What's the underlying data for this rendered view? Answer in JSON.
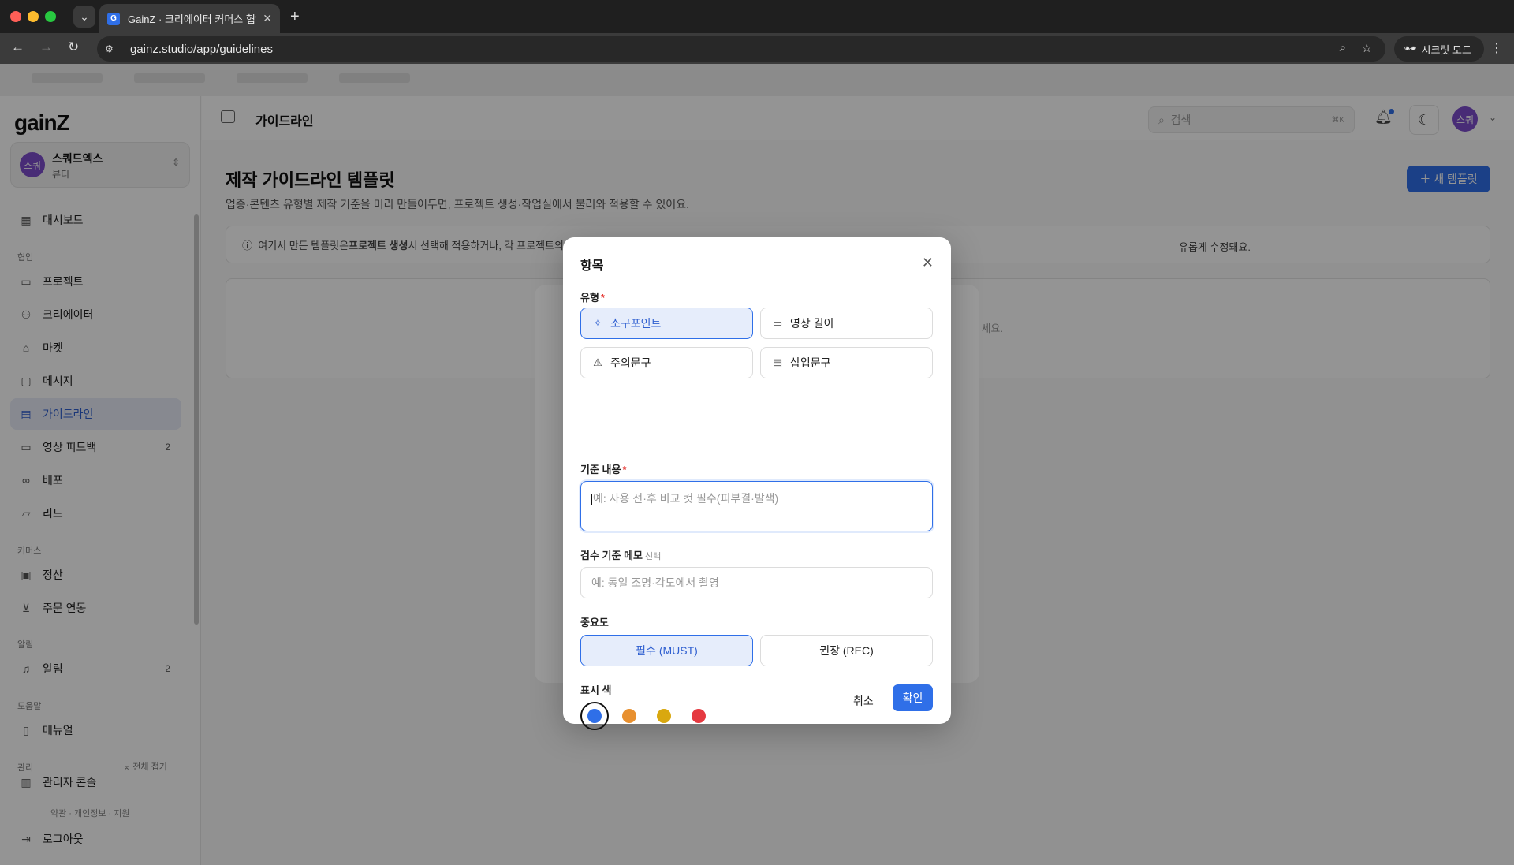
{
  "browser": {
    "tab_title": "GainZ · 크리에이터 커머스 협업 C",
    "tab_favicon": "G",
    "url": "gainz.studio/app/guidelines",
    "incognito_label": "시크릿 모드"
  },
  "sidebar": {
    "logo": "gainZ",
    "workspace": {
      "avatar": "스쿼",
      "name": "스쿼드엑스",
      "sub": "뷰티"
    },
    "sections": {
      "collab": "협업",
      "commerce": "커머스",
      "alerts": "알림",
      "help": "도움말",
      "admin": "관리"
    },
    "items": [
      {
        "label": "대시보드",
        "icon": "dashboard-icon"
      },
      {
        "label": "프로젝트",
        "icon": "folder-icon"
      },
      {
        "label": "크리에이터",
        "icon": "users-icon"
      },
      {
        "label": "마켓",
        "icon": "store-icon"
      },
      {
        "label": "메시지",
        "icon": "message-icon"
      },
      {
        "label": "가이드라인",
        "icon": "document-icon"
      },
      {
        "label": "영상 피드백",
        "icon": "video-icon",
        "badge": "2"
      },
      {
        "label": "배포",
        "icon": "link-icon"
      },
      {
        "label": "리드",
        "icon": "inbox-icon"
      },
      {
        "label": "정산",
        "icon": "wallet-icon"
      },
      {
        "label": "주문 연동",
        "icon": "cart-icon"
      },
      {
        "label": "알림",
        "icon": "bell-icon",
        "badge": "2"
      },
      {
        "label": "매뉴얼",
        "icon": "book-icon"
      },
      {
        "label": "관리자 콘솔",
        "icon": "admin-icon"
      }
    ],
    "collapse_all": "전체 접기",
    "footer_links": "약관 · 개인정보 · 지원",
    "logout": "로그아웃"
  },
  "topbar": {
    "title": "가이드라인",
    "search_placeholder": "검색",
    "search_shortcut": "⌘K",
    "avatar": "스쿼"
  },
  "main": {
    "title": "제작 가이드라인 템플릿",
    "description": "업종·콘텐츠 유형별 제작 기준을 미리 만들어두면, 프로젝트 생성·작업실에서 불러와 적용할 수 있어요.",
    "new_button": "새 템플릿",
    "info_prefix": "여기서 만든 템플릿은 ",
    "info_bold": "프로젝트 생성",
    "info_suffix": " 시 선택해 적용하거나, 각 프로젝트의",
    "info_tail": "유롭게 수정돼요."
  },
  "background_modal": {
    "hint_tail": "세요."
  },
  "modal": {
    "title": "항목",
    "type_label": "유형",
    "types": [
      {
        "label": "소구포인트",
        "icon": "sparkle-icon",
        "selected": true
      },
      {
        "label": "영상 길이",
        "icon": "video-icon",
        "selected": false
      },
      {
        "label": "주의문구",
        "icon": "warning-icon",
        "selected": false
      },
      {
        "label": "삽입문구",
        "icon": "document-icon",
        "selected": false
      }
    ],
    "content_label": "기준 내용",
    "content_placeholder": "예: 사용 전·후 비교 컷 필수(피부결·발색)",
    "memo_label": "검수 기준 메모",
    "memo_optional": "선택",
    "memo_placeholder": "예: 동일 조명·각도에서 촬영",
    "importance_label": "중요도",
    "importance": [
      {
        "label": "필수 (MUST)",
        "selected": true
      },
      {
        "label": "권장 (REC)",
        "selected": false
      }
    ],
    "color_label": "표시 색",
    "colors": [
      "#2f6fe8",
      "#e8902f",
      "#d9a80f",
      "#e53940"
    ],
    "selected_color_index": 0,
    "cancel": "취소",
    "confirm": "확인"
  }
}
